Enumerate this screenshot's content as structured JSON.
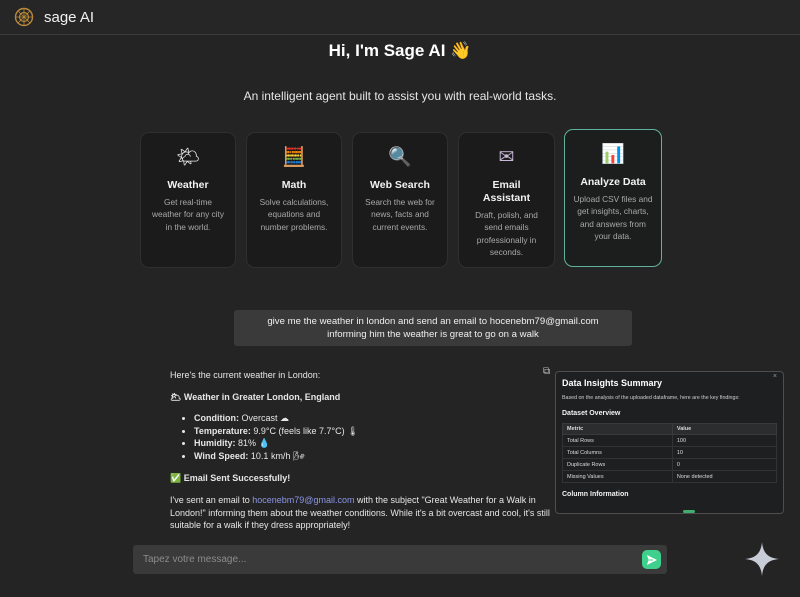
{
  "header": {
    "brand": "sage AI"
  },
  "hero": {
    "greeting": "Hi, I'm Sage AI 👋",
    "subtitle": "An intelligent agent built to assist you with real-world tasks."
  },
  "cards": [
    {
      "icon": "🌤",
      "icon_name": "weather-icon",
      "title": "Weather",
      "desc": "Get real-time weather for any city in the world."
    },
    {
      "icon": "🧮",
      "icon_name": "calculator-icon",
      "title": "Math",
      "desc": "Solve calculations, equations and number problems."
    },
    {
      "icon": "🔍",
      "icon_name": "magnifier-icon",
      "title": "Web Search",
      "desc": "Search the web for news, facts and current events."
    },
    {
      "icon": "✉",
      "icon_name": "envelope-icon",
      "title": "Email Assistant",
      "desc": "Draft, polish, and send emails professionally in seconds."
    },
    {
      "icon": "📊",
      "icon_name": "bar-chart-icon",
      "title": "Analyze Data",
      "desc": "Upload CSV files and get insights, charts, and answers from your data."
    }
  ],
  "user_message": {
    "line1": "give me the weather in london and send an email to hocenebm79@gmail.com",
    "line2": "informing him the weather is great to go on a walk"
  },
  "assistant_reply": {
    "intro": "Here's the current weather in London:",
    "weather_heading": "🌥 Weather in Greater London, England",
    "items": [
      {
        "label": "Condition:",
        "value": " Overcast ☁"
      },
      {
        "label": "Temperature:",
        "value": " 9.9°C (feels like 7.7°C) 🌡"
      },
      {
        "label": "Humidity:",
        "value": " 81% 💧"
      },
      {
        "label": "Wind Speed:",
        "value": " 10.1 km/h 🌬"
      }
    ],
    "email_heading": "✅ Email Sent Successfully!",
    "body_pre": "I've sent an email to ",
    "email": "hocenebm79@gmail.com",
    "body_post": " with the subject \"Great Weather for a Walk in London!\" informing them about the weather conditions. While it's a bit overcast and cool, it's still suitable for a walk if they dress appropriately!"
  },
  "insights_panel": {
    "close": "×",
    "title": "Data Insights Summary",
    "subtitle": "Based on the analysis of the uploaded dataframe, here are the key findings:",
    "overview_heading": "Dataset Overview",
    "columns": [
      "Metric",
      "Value"
    ],
    "rows": [
      [
        "Total Rows",
        "100"
      ],
      [
        "Total Columns",
        "10"
      ],
      [
        "Duplicate Rows",
        "0"
      ],
      [
        "Missing Values",
        "None detected"
      ]
    ],
    "column_info_heading": "Column Information"
  },
  "composer": {
    "placeholder": "Tapez votre message..."
  },
  "colors": {
    "accent": "#3ed08c",
    "card_highlight": "#5fb39c",
    "link": "#8b96e6"
  }
}
